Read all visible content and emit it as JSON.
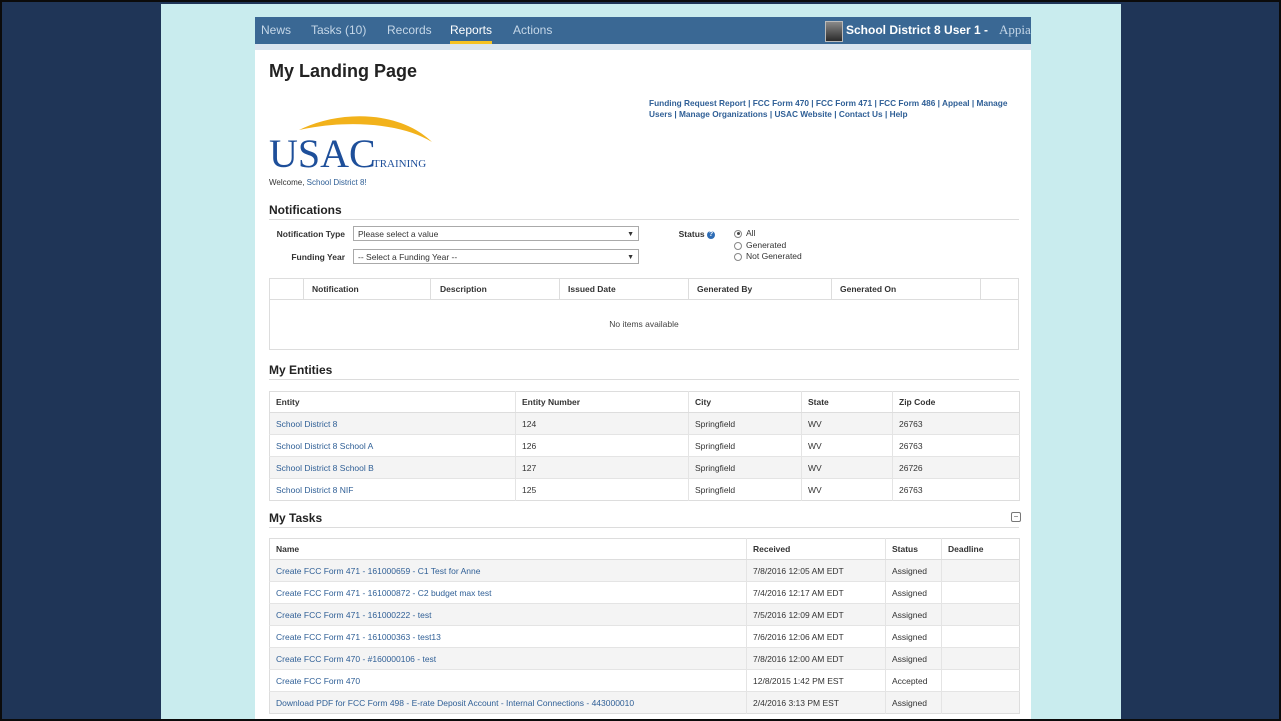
{
  "nav": {
    "tabs": [
      {
        "label": "News"
      },
      {
        "label": "Tasks (10)"
      },
      {
        "label": "Records"
      },
      {
        "label": "Reports"
      },
      {
        "label": "Actions"
      }
    ],
    "active_tab": "Reports",
    "user": "School District 8 User 1 -",
    "brand": "Appian"
  },
  "page": {
    "title": "My Landing Page",
    "quick_links": "Funding Request Report | FCC Form 470 | FCC Form 471 | FCC Form 486 | Appeal | Manage Users | Manage Organizations | USAC Website | Contact Us | Help",
    "logo": {
      "main": "USAC",
      "sub": "TRAINING"
    },
    "welcome_label": "Welcome,",
    "welcome_name": "School District 8!"
  },
  "notifications": {
    "title": "Notifications",
    "type_label": "Notification Type",
    "type_value": "Please select a value",
    "year_label": "Funding Year",
    "year_value": "-- Select a Funding Year --",
    "status_label": "Status",
    "status_options": [
      "All",
      "Generated",
      "Not Generated"
    ],
    "status_selected": "All",
    "columns": [
      "Notification",
      "Description",
      "Issued Date",
      "Generated By",
      "Generated On"
    ],
    "empty_message": "No items available"
  },
  "entities": {
    "title": "My Entities",
    "columns": [
      "Entity",
      "Entity Number",
      "City",
      "State",
      "Zip Code"
    ],
    "rows": [
      [
        "School District 8",
        "124",
        "Springfield",
        "WV",
        "26763"
      ],
      [
        "School District 8 School A",
        "126",
        "Springfield",
        "WV",
        "26763"
      ],
      [
        "School District 8 School B",
        "127",
        "Springfield",
        "WV",
        "26726"
      ],
      [
        "School District 8 NIF",
        "125",
        "Springfield",
        "WV",
        "26763"
      ]
    ]
  },
  "tasks": {
    "title": "My Tasks",
    "collapse_icon": "⊟",
    "columns": [
      "Name",
      "Received",
      "Status",
      "Deadline"
    ],
    "rows": [
      [
        "Create FCC Form 471 - 161000659 - C1 Test for Anne",
        "7/8/2016 12:05 AM EDT",
        "Assigned",
        ""
      ],
      [
        "Create FCC Form 471 - 161000872 - C2 budget max test",
        "7/4/2016 12:17 AM EDT",
        "Assigned",
        ""
      ],
      [
        "Create FCC Form 471 - 161000222 - test",
        "7/5/2016 12:09 AM EDT",
        "Assigned",
        ""
      ],
      [
        "Create FCC Form 471 - 161000363 - test13",
        "7/6/2016 12:06 AM EDT",
        "Assigned",
        ""
      ],
      [
        "Create FCC Form 470 - #160000106 - test",
        "7/8/2016 12:00 AM EDT",
        "Assigned",
        ""
      ],
      [
        "Create FCC Form 470",
        "12/8/2015 1:42 PM EST",
        "Accepted",
        ""
      ],
      [
        "Download PDF for FCC Form 498 - E-rate Deposit Account - Internal Connections - 443000010",
        "2/4/2016 3:13 PM EST",
        "Assigned",
        ""
      ]
    ]
  },
  "colors": {
    "background": "#1f3557",
    "slide": "#c9ecee",
    "nav": "#3a6894",
    "accent": "#f5c223",
    "link": "#2f5f96"
  }
}
